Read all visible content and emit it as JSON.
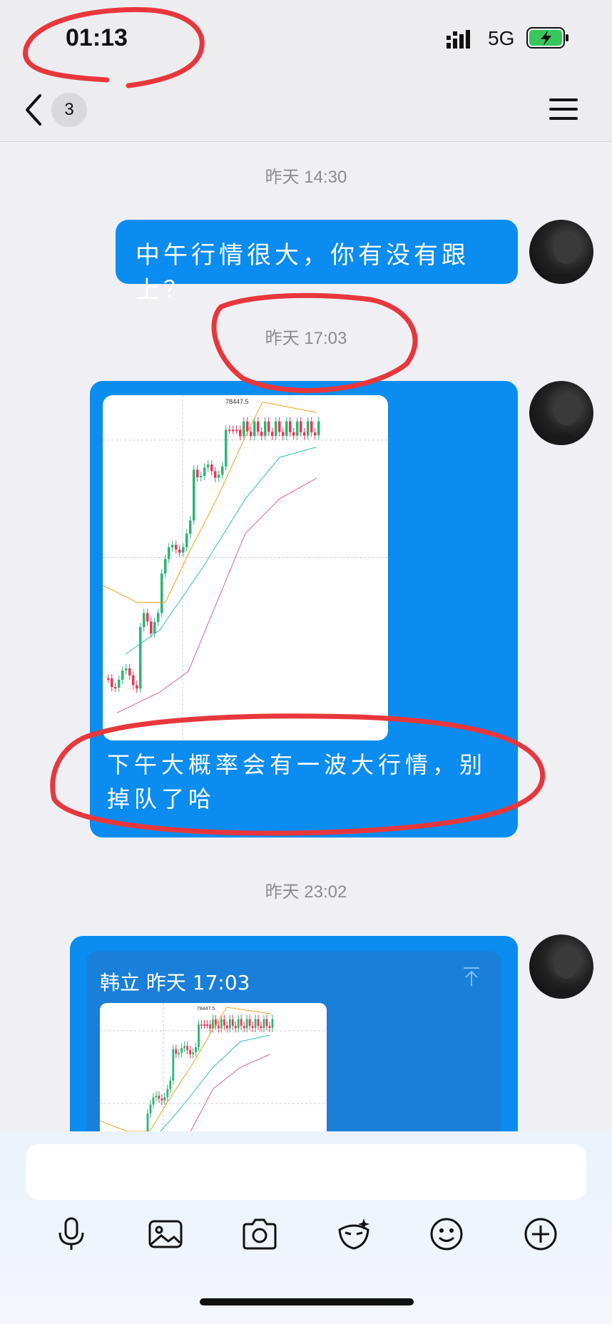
{
  "status_bar": {
    "time": "01:13",
    "network": "5G"
  },
  "nav": {
    "unread_count": "3"
  },
  "messages": [
    {
      "timestamp": "昨天 14:30",
      "text": "中午行情很大，你有没有跟上？"
    },
    {
      "timestamp": "昨天 17:03",
      "text": "下午大概率会有一波大行情，别掉队了哈",
      "chart_label": "78447.5"
    },
    {
      "timestamp": "昨天 23:02",
      "quote_header": "韩立 昨天 17:03",
      "chart_label": "78447.5"
    }
  ],
  "colors": {
    "bubble": "#0a8cf0",
    "annotation": "#e8373c",
    "background": "#f0f0f4"
  },
  "toolbar_icons": [
    "microphone-icon",
    "image-icon",
    "camera-icon",
    "sticker-icon",
    "emoji-icon",
    "add-icon"
  ]
}
